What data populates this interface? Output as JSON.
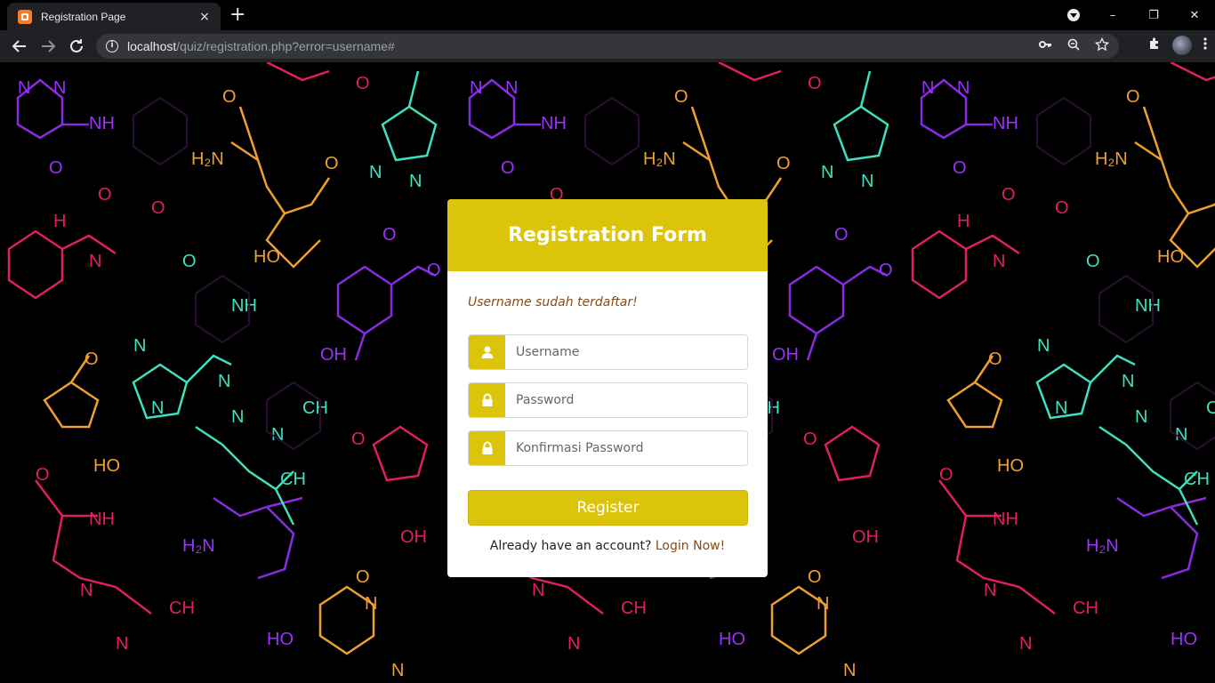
{
  "browser": {
    "tab_title": "Registration Page",
    "tab_close": "×",
    "new_tab": "+",
    "url_host": "localhost",
    "url_path": "/quiz/registration.php?error=username#",
    "window_controls": {
      "minimize": "–",
      "restore": "❐",
      "close": "✕"
    },
    "icons": {
      "key": "key-icon",
      "zoom": "zoom-icon",
      "star": "star-icon",
      "extensions": "puzzle-icon",
      "menu": "kebab-menu-icon"
    }
  },
  "form": {
    "title": "Registration Form",
    "error_message": "Username sudah terdaftar!",
    "fields": {
      "username_placeholder": "Username",
      "password_placeholder": "Password",
      "confirm_placeholder": "Konfirmasi Password"
    },
    "register_label": "Register",
    "login_prompt": "Already have an account?",
    "login_link": "Login Now!"
  },
  "colors": {
    "accent": "#dbc40a",
    "error_text": "#8a4a12",
    "background": "#000000"
  }
}
